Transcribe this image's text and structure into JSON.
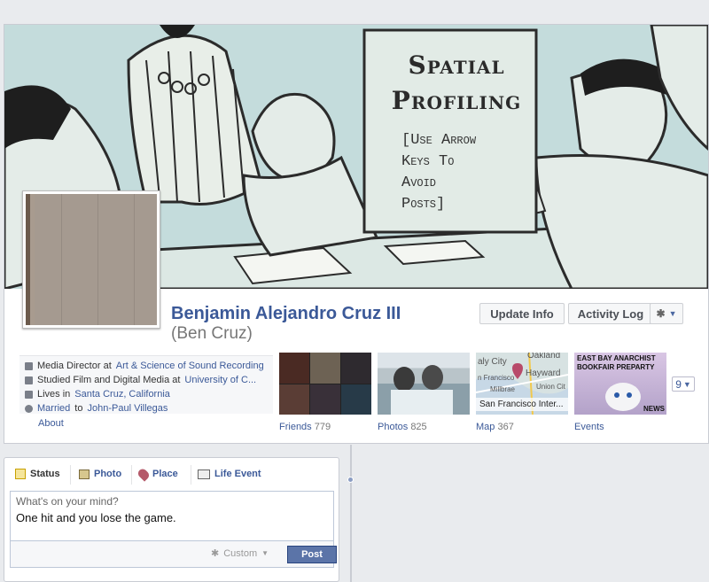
{
  "cover": {
    "title_lines": [
      "Spatial",
      "Profiling"
    ],
    "subtitle_lines": [
      "[Use Arrow",
      "Keys To",
      "Avoid",
      "Posts]"
    ]
  },
  "profile": {
    "name": "Benjamin Alejandro Cruz III",
    "nickname": "(Ben Cruz)"
  },
  "actions": {
    "update_info": "Update Info",
    "activity_log": "Activity Log"
  },
  "info": {
    "work_prefix": "Media Director at ",
    "work_link": "Art & Science of Sound Recording",
    "study_prefix": "Studied Film and Digital Media at ",
    "study_link": "University of C...",
    "lives_prefix": "Lives in ",
    "lives_link": "Santa Cruz, California",
    "married_link": "Married",
    "married_mid": " to ",
    "married_person": "John-Paul Villegas",
    "about": "About"
  },
  "tiles": {
    "friends": {
      "label": "Friends",
      "count": "779"
    },
    "photos": {
      "label": "Photos",
      "count": "825"
    },
    "map": {
      "label": "Map",
      "count": "367"
    },
    "events": {
      "label": "Events"
    },
    "map_labels": [
      "aly City",
      "Oakland",
      "Hayward",
      "n Francisco",
      "Millbrae",
      "Union Cit",
      "San Francisco Inter..."
    ],
    "events_text": [
      "EAST BAY ANARCHIST",
      "BOOKFAIR PREPARTY",
      "NEWS"
    ],
    "more_count": "9"
  },
  "composer": {
    "tabs": [
      "Status",
      "Photo",
      "Place",
      "Life Event"
    ],
    "placeholder": "What's on your mind?",
    "text": "One hit and you lose the game.",
    "privacy": "Custom",
    "post": "Post"
  },
  "colors": {
    "link": "#3b5998",
    "cover_bg": "#c4dcdc",
    "post_button": "#5b74a8"
  }
}
